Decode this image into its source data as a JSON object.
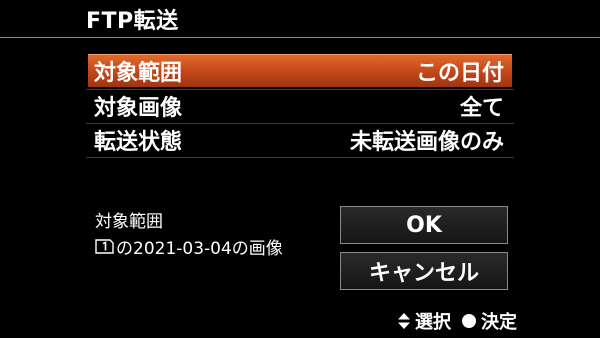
{
  "header": {
    "title": "FTP転送"
  },
  "menu": {
    "rows": [
      {
        "label": "対象範囲",
        "value": "この日付"
      },
      {
        "label": "対象画像",
        "value": "全て"
      },
      {
        "label": "転送状態",
        "value": "未転送画像のみ"
      }
    ]
  },
  "info": {
    "label": "対象範囲",
    "value": "の2021-03-04の画像"
  },
  "buttons": {
    "ok": "OK",
    "cancel": "キャンセル"
  },
  "footer": {
    "select_label": "選択",
    "confirm_label": "決定"
  },
  "colors": {
    "highlight": "#c2461a",
    "background": "#000000"
  }
}
